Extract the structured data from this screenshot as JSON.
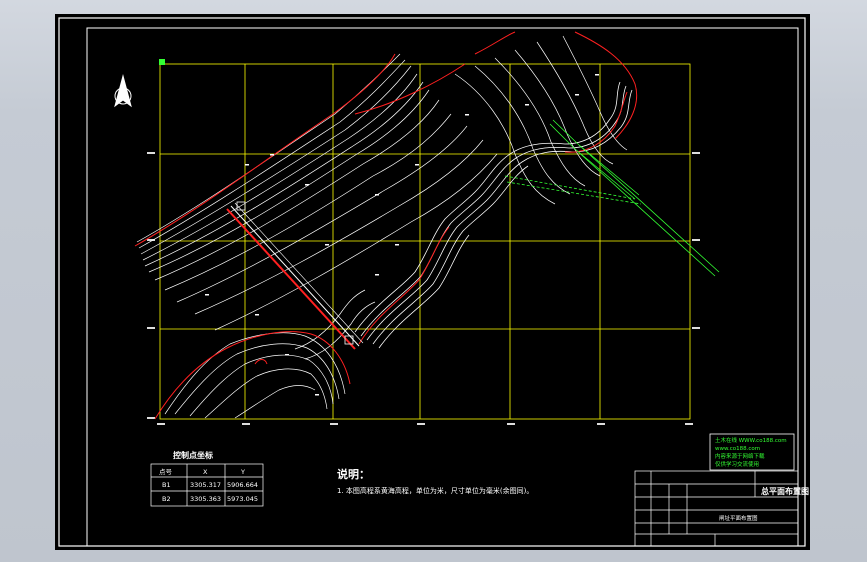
{
  "legend_table": {
    "title": "控制点坐标",
    "headers": [
      "点号",
      "X",
      "Y"
    ],
    "rows": [
      [
        "B1",
        "3305.317",
        "5906.664"
      ],
      [
        "B2",
        "3305.363",
        "5973.045"
      ]
    ]
  },
  "notes": {
    "heading": "说明：",
    "line1": "1. 本图高程系黄海高程，单位为米，尺寸单位为毫米(余图同)。"
  },
  "title_block": {
    "drawing_title": "总平面布置图",
    "sub_title": "闸址平面布置图",
    "stamp_lines": [
      "土木在线 WWW.co188.com",
      "www.co188.com",
      "内容来源于网络下载",
      "仅供学习交流使用"
    ]
  },
  "tools": {
    "north_arrow": "north-arrow-icon"
  },
  "colors": {
    "grid": "#ffff00",
    "contour": "#ffffff",
    "red_line": "#ff2020",
    "green": "#33ff33"
  }
}
